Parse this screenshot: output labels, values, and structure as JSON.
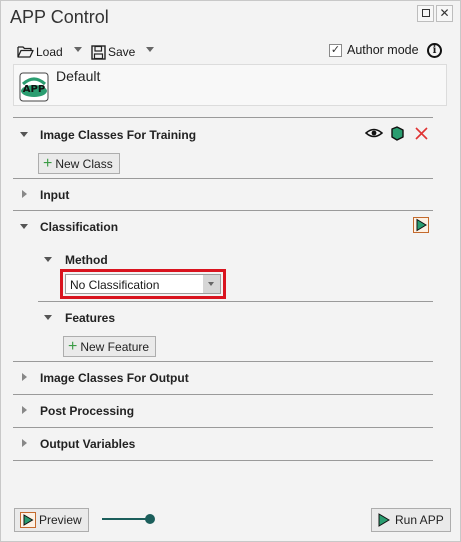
{
  "window": {
    "title": "APP Control"
  },
  "toolbar": {
    "load_label": "Load",
    "save_label": "Save",
    "author_mode_label": "Author mode",
    "author_mode_checked": "✓"
  },
  "app": {
    "name": "Default",
    "icon_text": "APP"
  },
  "sections": {
    "training": {
      "title": "Image Classes For Training",
      "new_class_label": "New Class"
    },
    "input": {
      "title": "Input"
    },
    "classification": {
      "title": "Classification",
      "method": {
        "title": "Method",
        "selected": "No Classification"
      },
      "features": {
        "title": "Features",
        "new_feature_label": "New Feature"
      }
    },
    "output_classes": {
      "title": "Image Classes For Output"
    },
    "post": {
      "title": "Post Processing"
    },
    "output_vars": {
      "title": "Output Variables"
    }
  },
  "footer": {
    "preview_label": "Preview",
    "run_label": "Run APP"
  },
  "colors": {
    "accent_green": "#2a9d70",
    "close_red": "#e03333",
    "highlight_red": "#d9141f",
    "play_orange": "#c46a2d"
  },
  "icons": [
    "folder-open-icon",
    "floppy-disk-icon",
    "info-icon",
    "eye-icon",
    "tag-icon",
    "close-icon",
    "play-icon",
    "plus-icon"
  ]
}
